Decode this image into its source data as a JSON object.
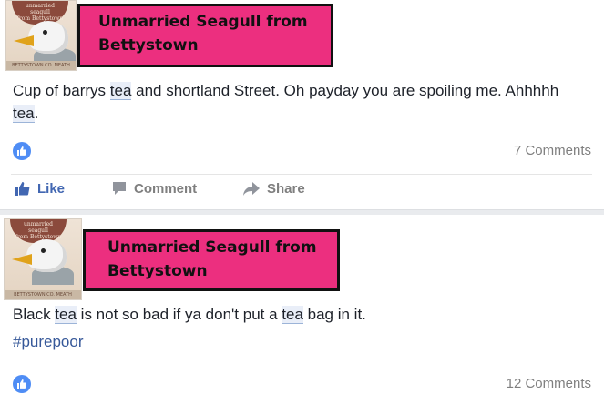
{
  "posts": [
    {
      "author": "Unmarried Seagull from Bettystown",
      "avatar_badge": "unmarried seagull from Bettystown",
      "avatar_footer": "BETTYSTOWN CO. MEATH",
      "text_parts": [
        "Cup of barrys ",
        "tea",
        " and shortland Street. Oh payday you are spoiling me. Ahhhhh ",
        "tea",
        "."
      ],
      "comments_count": "7 Comments",
      "actions": {
        "like": "Like",
        "comment": "Comment",
        "share": "Share"
      }
    },
    {
      "author": "Unmarried Seagull from Bettystown",
      "avatar_badge": "unmarried seagull from Bettystown",
      "avatar_footer": "BETTYSTOWN CO. MEATH",
      "text_parts": [
        "Black ",
        "tea",
        " is not so bad if ya don't put a ",
        "tea",
        " bag in it."
      ],
      "hashtag": "#purepoor",
      "comments_count": "12 Comments"
    }
  ],
  "colors": {
    "name_box_bg": "#ec2f7f",
    "like_blue": "#4267b2",
    "like_bubble": "#4f8df5",
    "hashtag": "#365899"
  },
  "icons": {
    "like": "thumbs-up-icon",
    "comment": "speech-bubble-icon",
    "share": "share-arrow-icon"
  }
}
